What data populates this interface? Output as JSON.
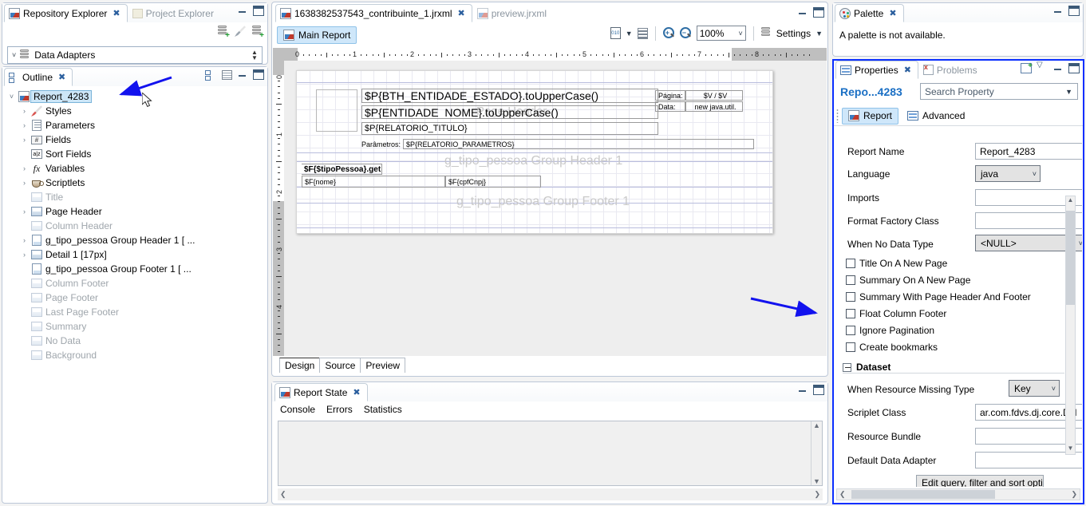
{
  "repository": {
    "tabs": [
      {
        "label": "Repository Explorer",
        "active": true,
        "icon": "jasper-report-icon"
      },
      {
        "label": "Project Explorer",
        "active": false,
        "icon": "project-folder-icon"
      }
    ],
    "toolbar_icons": [
      "new-data-adapter-icon",
      "connection-test-icon",
      "new-server-icon"
    ],
    "tree_root": "Data Adapters"
  },
  "outline": {
    "tab_label": "Outline",
    "toolbar_icons": [
      "link-with-editor-icon",
      "filter-icon"
    ],
    "nodes": [
      {
        "label": "Report_4283",
        "indent": 0,
        "expander": "expanded",
        "icon": "jasper-report-icon",
        "selected": true,
        "dim": false
      },
      {
        "label": "Styles",
        "indent": 1,
        "expander": "collapsed",
        "icon": "styles-pencil-icon",
        "selected": false,
        "dim": false
      },
      {
        "label": "Parameters",
        "indent": 1,
        "expander": "collapsed",
        "icon": "parameters-icon",
        "selected": false,
        "dim": false
      },
      {
        "label": "Fields",
        "indent": 1,
        "expander": "collapsed",
        "icon": "fields-icon",
        "selected": false,
        "dim": false
      },
      {
        "label": "Sort Fields",
        "indent": 1,
        "expander": "none",
        "icon": "sort-fields-icon",
        "selected": false,
        "dim": false
      },
      {
        "label": "Variables",
        "indent": 1,
        "expander": "collapsed",
        "icon": "variables-fx-icon",
        "selected": false,
        "dim": false
      },
      {
        "label": "Scriptlets",
        "indent": 1,
        "expander": "collapsed",
        "icon": "scriptlets-coffee-icon",
        "selected": false,
        "dim": false
      },
      {
        "label": "Title",
        "indent": 1,
        "expander": "none",
        "icon": "band-icon",
        "selected": false,
        "dim": true
      },
      {
        "label": "Page Header",
        "indent": 1,
        "expander": "collapsed",
        "icon": "band-icon",
        "selected": false,
        "dim": false
      },
      {
        "label": "Column Header",
        "indent": 1,
        "expander": "none",
        "icon": "band-icon",
        "selected": false,
        "dim": true
      },
      {
        "label": "g_tipo_pessoa Group Header 1 [ ...",
        "indent": 1,
        "expander": "collapsed",
        "icon": "group-header-icon",
        "selected": false,
        "dim": false
      },
      {
        "label": "Detail 1 [17px]",
        "indent": 1,
        "expander": "collapsed",
        "icon": "band-icon",
        "selected": false,
        "dim": false
      },
      {
        "label": "g_tipo_pessoa Group Footer 1 [ ...",
        "indent": 1,
        "expander": "none",
        "icon": "group-footer-icon",
        "selected": false,
        "dim": false
      },
      {
        "label": "Column Footer",
        "indent": 1,
        "expander": "none",
        "icon": "band-icon",
        "selected": false,
        "dim": true
      },
      {
        "label": "Page Footer",
        "indent": 1,
        "expander": "none",
        "icon": "band-icon",
        "selected": false,
        "dim": true
      },
      {
        "label": "Last Page Footer",
        "indent": 1,
        "expander": "none",
        "icon": "band-icon",
        "selected": false,
        "dim": true
      },
      {
        "label": "Summary",
        "indent": 1,
        "expander": "none",
        "icon": "band-icon",
        "selected": false,
        "dim": true
      },
      {
        "label": "No Data",
        "indent": 1,
        "expander": "none",
        "icon": "band-icon",
        "selected": false,
        "dim": true
      },
      {
        "label": "Background",
        "indent": 1,
        "expander": "none",
        "icon": "band-icon",
        "selected": false,
        "dim": true
      }
    ]
  },
  "editor": {
    "tabs": [
      {
        "label": "1638382537543_contribuinte_1.jrxml",
        "active": true
      },
      {
        "label": "preview.jrxml",
        "active": false
      }
    ],
    "main_report_button": "Main Report",
    "zoom_value": "100%",
    "settings_label": "Settings",
    "toolbar_icons": [
      "dataset-icon",
      "bands-icon",
      "zoom-in-icon",
      "zoom-out-icon",
      "settings-icon"
    ],
    "bottom_tabs": [
      {
        "label": "Design",
        "active": true
      },
      {
        "label": "Source",
        "active": false
      },
      {
        "label": "Preview",
        "active": false
      }
    ],
    "ruler": {
      "h_labels": [
        "0",
        "1",
        "2",
        "3",
        "4",
        "5",
        "6",
        "7",
        "8"
      ],
      "v_labels": [
        "0",
        "1",
        "2",
        "3",
        "4"
      ]
    },
    "design": {
      "bands": [
        {
          "label": "Page Header"
        },
        {
          "label": "g_tipo_pessoa Group Header 1"
        },
        {
          "label": "g_tipo_pessoa Group Footer 1"
        }
      ],
      "elements": [
        {
          "name": "entidade-estado-field",
          "text": "$P{BTH_ENTIDADE_ESTADO}.toUpperCase()"
        },
        {
          "name": "entidade-nome-field",
          "text": "$P{ENTIDADE_NOME}.toUpperCase()"
        },
        {
          "name": "relatorio-titulo-field",
          "text": "$P{RELATORIO_TITULO}"
        },
        {
          "name": "parametros-label",
          "text": "Parâmetros:"
        },
        {
          "name": "relatorio-parametros-field",
          "text": "$P{RELATORIO_PARAMETROS}"
        },
        {
          "name": "pagina-label",
          "text": "Página:"
        },
        {
          "name": "pagina-value",
          "text": "$V / $V"
        },
        {
          "name": "data-label",
          "text": "Data:"
        },
        {
          "name": "data-value",
          "text": "new java.util."
        },
        {
          "name": "tipo-pessoa-field",
          "text": "$F{$tipoPessoa}.get"
        },
        {
          "name": "nome-field",
          "text": "$F{nome}"
        },
        {
          "name": "cpfcnpj-field",
          "text": "$F{cpfCnpj}"
        }
      ]
    }
  },
  "report_state": {
    "tab_label": "Report State",
    "subtabs": [
      "Console",
      "Errors",
      "Statistics"
    ],
    "content": ""
  },
  "palette": {
    "tab_label": "Palette",
    "message": "A palette is not available."
  },
  "properties": {
    "tabs": [
      {
        "label": "Properties",
        "active": true
      },
      {
        "label": "Problems",
        "active": false
      }
    ],
    "object_name": "Repo...4283",
    "search_placeholder": "Search Property",
    "section_tabs": [
      {
        "label": "Report",
        "active": true
      },
      {
        "label": "Advanced",
        "active": false
      }
    ],
    "fields": [
      {
        "label": "Report Name",
        "value": "Report_4283",
        "type": "text"
      },
      {
        "label": "Language",
        "value": "java",
        "type": "select"
      },
      {
        "label": "Imports",
        "value": "",
        "type": "text"
      },
      {
        "label": "Format Factory Class",
        "value": "",
        "type": "text"
      },
      {
        "label": "When No Data Type",
        "value": "<NULL>",
        "type": "select"
      }
    ],
    "checkboxes": [
      {
        "label": "Title On A New Page",
        "checked": false
      },
      {
        "label": "Summary On A New Page",
        "checked": false
      },
      {
        "label": "Summary With Page Header And Footer",
        "checked": false
      },
      {
        "label": "Float Column Footer",
        "checked": false
      },
      {
        "label": "Ignore Pagination",
        "checked": false
      },
      {
        "label": "Create bookmarks",
        "checked": false
      }
    ],
    "dataset_section": {
      "title": "Dataset",
      "fields": [
        {
          "label": "When Resource Missing Type",
          "value": "Key",
          "type": "select"
        },
        {
          "label": "Scriplet Class",
          "value": "ar.com.fdvs.dj.core.DJl",
          "type": "text"
        },
        {
          "label": "Resource Bundle",
          "value": "",
          "type": "text"
        },
        {
          "label": "Default Data Adapter",
          "value": "",
          "type": "text"
        }
      ],
      "button": "Edit query, filter and sort options"
    }
  },
  "annotations": {
    "arrow_color": "#1212ee",
    "arrows": [
      {
        "name": "arrow-to-report-node"
      },
      {
        "name": "arrow-to-properties-panel"
      }
    ]
  }
}
